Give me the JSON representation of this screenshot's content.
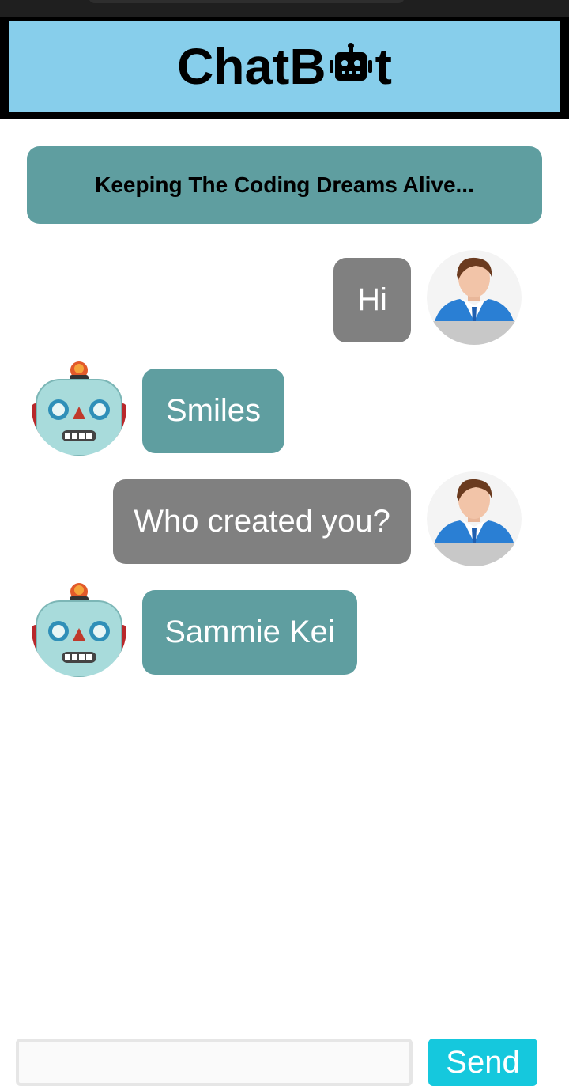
{
  "header": {
    "title_prefix": "ChatB",
    "title_suffix": "t",
    "title_icon": "robot-icon",
    "background": "#87ceeb"
  },
  "banner": {
    "text": "Keeping The Coding Dreams Alive...",
    "background": "#5f9ea0"
  },
  "messages": [
    {
      "sender": "user",
      "text": "Hi",
      "avatar": "user-avatar-icon"
    },
    {
      "sender": "bot",
      "text": "Smiles",
      "avatar": "robot-avatar-icon"
    },
    {
      "sender": "user",
      "text": "Who created you?",
      "avatar": "user-avatar-icon"
    },
    {
      "sender": "bot",
      "text": "Sammie Kei",
      "avatar": "robot-avatar-icon"
    }
  ],
  "composer": {
    "input_value": "",
    "send_label": "Send"
  },
  "colors": {
    "user_bubble": "#808080",
    "bot_bubble": "#5f9ea0",
    "send_button": "#15c8dd"
  }
}
